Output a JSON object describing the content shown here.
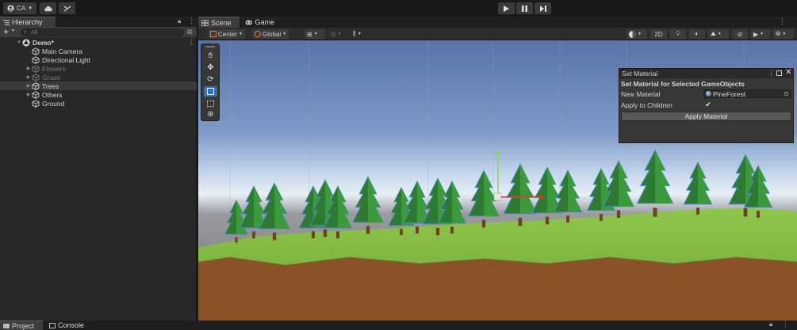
{
  "toolbar": {
    "account": "CA",
    "account_icon": "account-icon",
    "cloud_icon": "cloud-icon",
    "collab_icon": "collab-icon",
    "play_icon": "play-icon",
    "pause_icon": "pause-icon",
    "step_icon": "step-icon"
  },
  "hierarchy": {
    "tab": "Hierarchy",
    "search_placeholder": "All",
    "add_label": "+",
    "items": [
      {
        "label": "Demo*",
        "depth": 0,
        "expanded": true,
        "type": "scene"
      },
      {
        "label": "Main Camera",
        "depth": 1,
        "type": "gameobject"
      },
      {
        "label": "Directional Light",
        "depth": 1,
        "type": "gameobject"
      },
      {
        "label": "Flowers",
        "depth": 1,
        "type": "gameobject",
        "collapsed": true,
        "inactive": true
      },
      {
        "label": "Grass",
        "depth": 1,
        "type": "gameobject",
        "collapsed": true,
        "inactive": true
      },
      {
        "label": "Trees",
        "depth": 1,
        "type": "gameobject",
        "collapsed": true,
        "selected": true
      },
      {
        "label": "Others",
        "depth": 1,
        "type": "gameobject",
        "collapsed": true
      },
      {
        "label": "Ground",
        "depth": 1,
        "type": "gameobject"
      }
    ]
  },
  "scene": {
    "tabs": [
      {
        "label": "Scene",
        "active": true
      },
      {
        "label": "Game",
        "active": false
      }
    ],
    "pivot_mode": "Center",
    "pivot_rotation": "Global",
    "mode_2d": "2D"
  },
  "set_material": {
    "title": "Set Material",
    "heading": "Set Material for Selected GameObjects",
    "new_material_label": "New Material",
    "new_material_value": "PineForest",
    "apply_children_label": "Apply to Children",
    "apply_children_checked": true,
    "apply_button": "Apply Material"
  },
  "bottom": {
    "tabs": [
      {
        "label": "Project"
      },
      {
        "label": "Console"
      }
    ]
  },
  "colors": {
    "accent": "#3a72b0",
    "selection": "#3b3b3b",
    "sky_top": "#5574a8",
    "grass": "#7ab33e",
    "dirt": "#8c5228"
  }
}
